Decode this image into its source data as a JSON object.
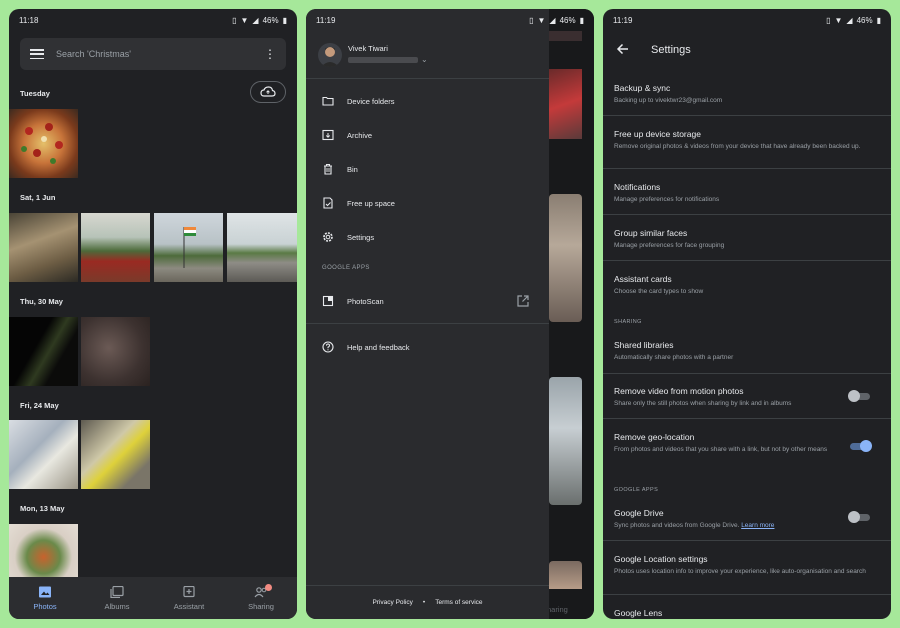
{
  "photos_screen": {
    "status": {
      "time": "11:18",
      "battery": "46%"
    },
    "search": {
      "placeholder": "Search 'Christmas'"
    },
    "sections": [
      "Tuesday",
      "Sat, 1 Jun",
      "Thu, 30 May",
      "Fri, 24 May",
      "Mon, 13 May"
    ],
    "nav": [
      "Photos",
      "Albums",
      "Assistant",
      "Sharing"
    ]
  },
  "drawer_screen": {
    "status": {
      "time": "11:19",
      "battery": "46%"
    },
    "account": {
      "name": "Vivek Tiwari"
    },
    "items": [
      "Device folders",
      "Archive",
      "Bin",
      "Free up space",
      "Settings"
    ],
    "google_apps_header": "GOOGLE APPS",
    "apps": [
      "PhotoScan"
    ],
    "help": "Help and feedback",
    "footer": {
      "privacy": "Privacy Policy",
      "dot": "•",
      "terms": "Terms of service"
    },
    "bg_nav_label": "naring"
  },
  "settings_screen": {
    "status": {
      "time": "11:19",
      "battery": "46%"
    },
    "title": "Settings",
    "rows": [
      {
        "title": "Backup & sync",
        "subtitle": "Backing up to vivektwr23@gmail.com"
      },
      {
        "title": "Free up device storage",
        "subtitle": "Remove original photos & videos from your device that have already been backed up."
      },
      {
        "title": "Notifications",
        "subtitle": "Manage preferences for notifications"
      },
      {
        "title": "Group similar faces",
        "subtitle": "Manage preferences for face grouping"
      },
      {
        "title": "Assistant cards",
        "subtitle": "Choose the card types to show"
      }
    ],
    "sharing_header": "SHARING",
    "sharing_rows": [
      {
        "title": "Shared libraries",
        "subtitle": "Automatically share photos with a partner"
      },
      {
        "title": "Remove video from motion photos",
        "subtitle": "Share only the still photos when sharing by link and in albums",
        "toggle": false
      },
      {
        "title": "Remove geo-location",
        "subtitle": "From photos and videos that you share with a link, but not by other means",
        "toggle": true
      }
    ],
    "google_apps_header": "GOOGLE APPS",
    "apps_rows": [
      {
        "title": "Google Drive",
        "subtitle": "Sync photos and videos from Google Drive.",
        "link": "Learn more",
        "toggle": false
      },
      {
        "title": "Google Location settings",
        "subtitle": "Photos uses location info to improve your experience, like auto-organisation and search"
      },
      {
        "title": "Google Lens"
      }
    ]
  },
  "colors": {
    "accent": "#8ab4f8",
    "background": "#202124",
    "frame": "#a6e89a",
    "badge": "#f28b82"
  }
}
